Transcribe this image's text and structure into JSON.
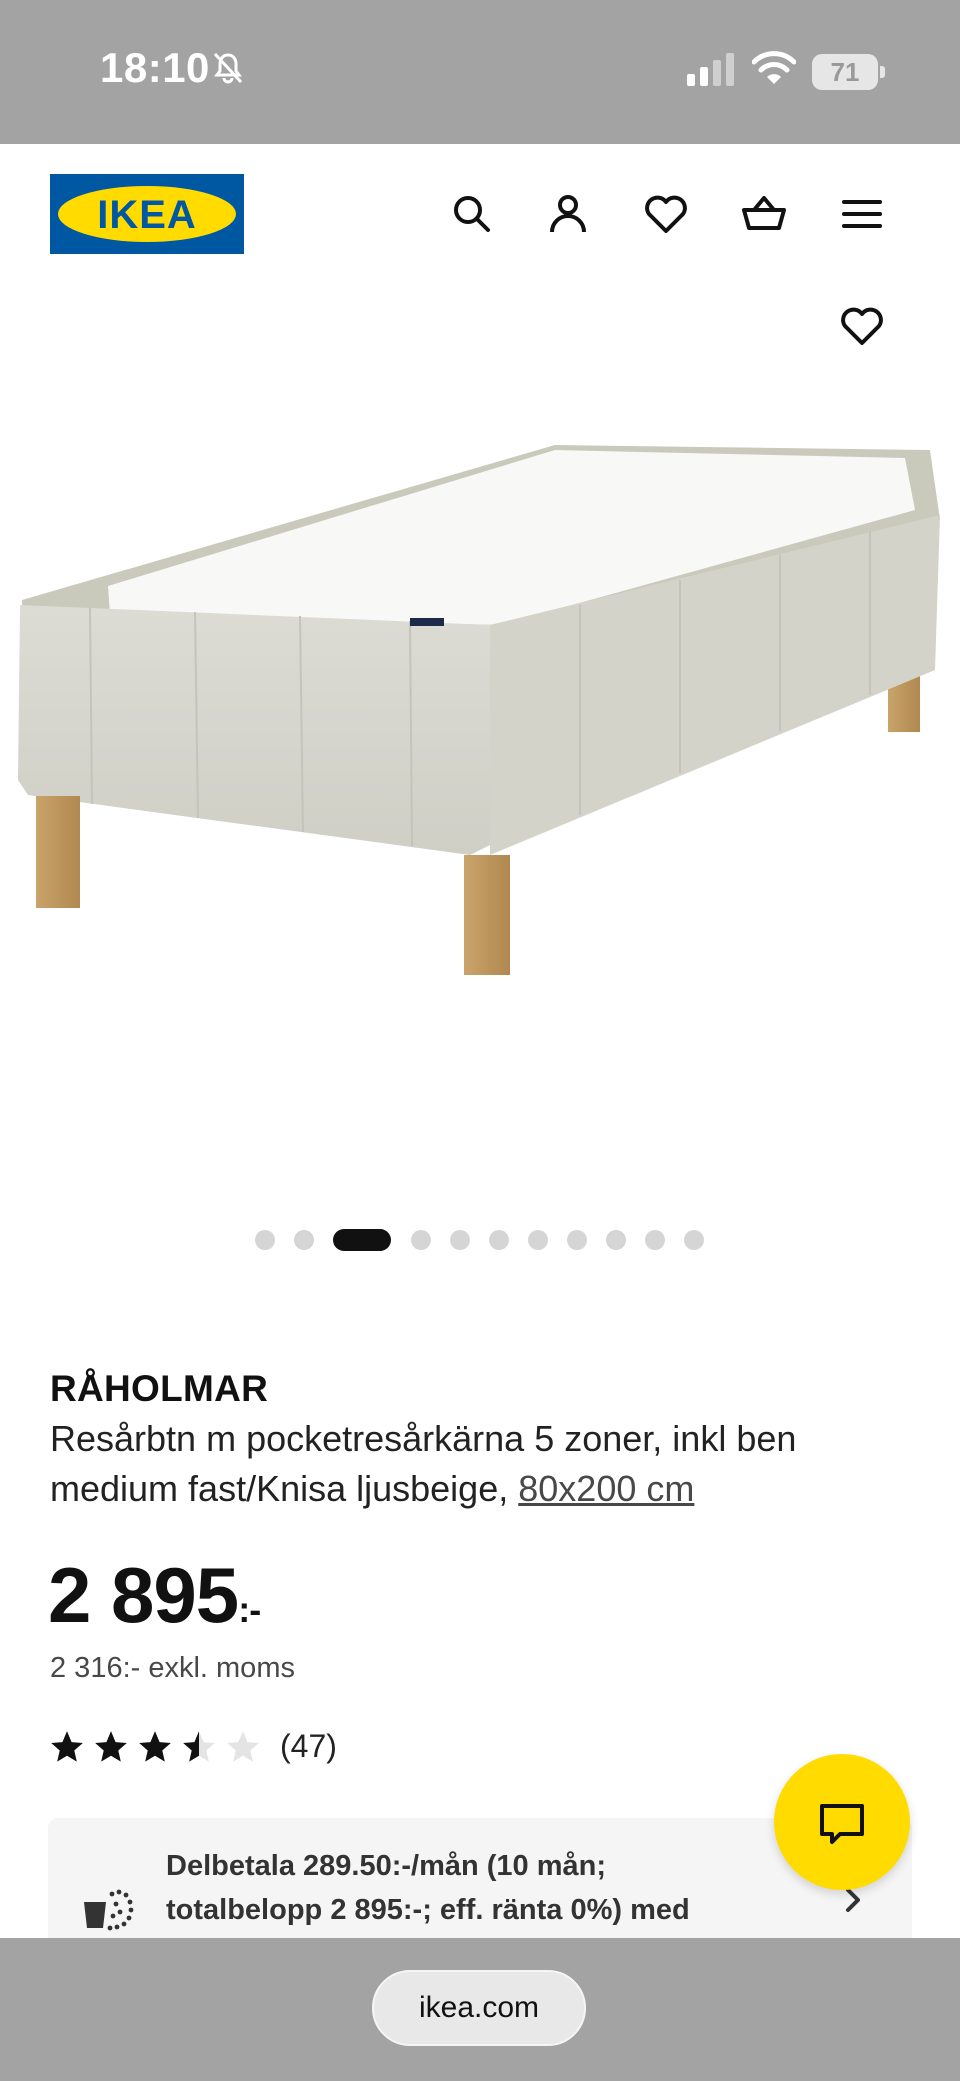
{
  "status_bar": {
    "time": "18:10",
    "battery": "71"
  },
  "header": {
    "logo_text": "IKEA",
    "icons": [
      "search-icon",
      "account-icon",
      "wishlist-icon",
      "basket-icon",
      "menu-icon"
    ]
  },
  "carousel": {
    "dot_count": 11,
    "active_index": 2
  },
  "product": {
    "name": "RÅHOLMAR",
    "description": "Resårbtn m pocketresårkärna 5 zoner, inkl ben medium fast/Knisa ljusbeige,",
    "size_link": "80x200 cm",
    "price_main": "2 895",
    "price_suffix": ":-",
    "price_ex_vat": "2 316:- exkl. moms",
    "rating_value": 3.5,
    "rating_max": 5,
    "rating_count": "(47)"
  },
  "payment": {
    "line1": "Delbetala 289.50:-/mån (10 mån;",
    "line2": "totalbelopp 2 895:-; eff. ränta 0%) med"
  },
  "browser": {
    "url": "ikea.com"
  },
  "colors": {
    "brand_blue": "#0058a3",
    "brand_yellow": "#ffdb00",
    "status_gray": "#a3a3a3"
  }
}
